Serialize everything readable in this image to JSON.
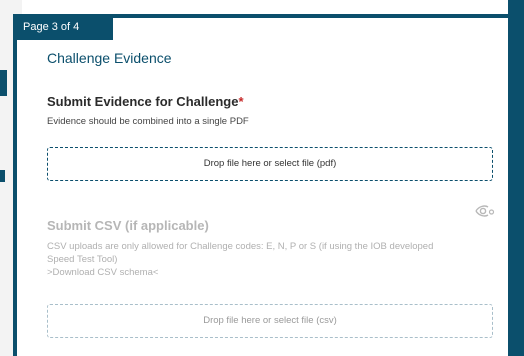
{
  "page": {
    "indicator": "Page 3 of 4",
    "title": "Challenge Evidence"
  },
  "evidence": {
    "heading": "Submit Evidence for Challenge",
    "required_mark": "*",
    "subtext": "Evidence should be combined into a single PDF",
    "dropzone_label": "Drop file here or select file (pdf)"
  },
  "csv": {
    "heading": "Submit CSV (if applicable)",
    "description_line1": "CSV uploads are only allowed for Challenge codes: E, N, P or S (if using the IOB developed",
    "description_line2": "Speed Test Tool)",
    "schema_link": ">Download CSV schema<",
    "dropzone_label": "Drop file here or select file (csv)",
    "state": "disabled"
  },
  "icons": {
    "visibility": "eye-icon"
  },
  "colors": {
    "primary": "#0b4f6c",
    "required": "#c62828",
    "disabled_text": "#b0b0b0"
  }
}
